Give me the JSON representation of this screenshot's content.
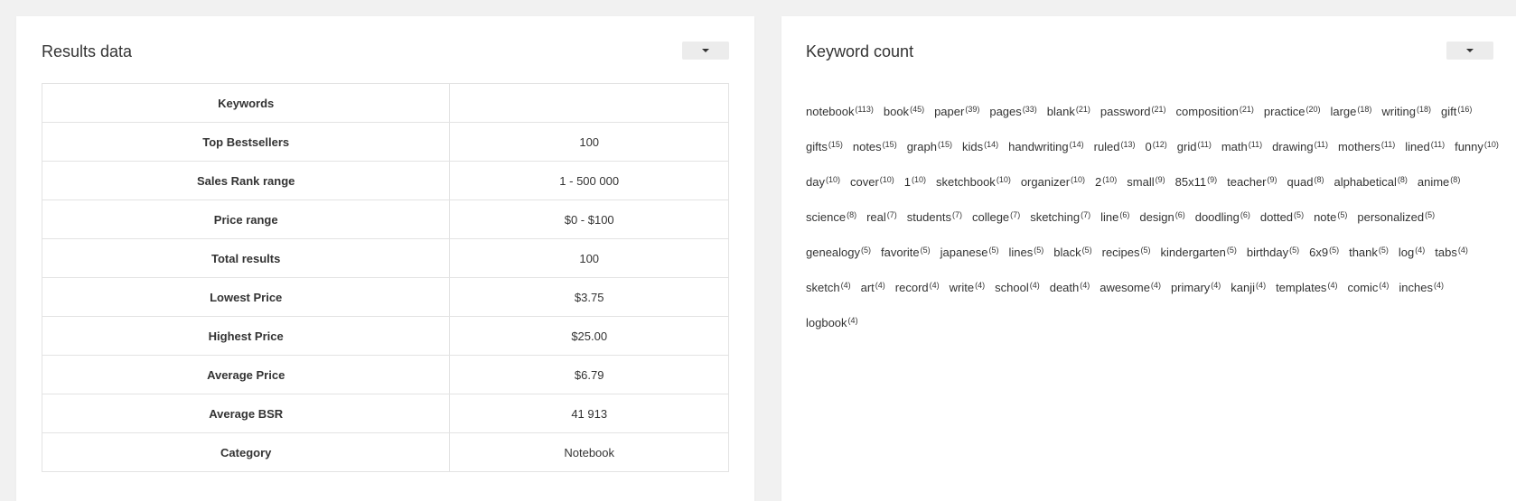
{
  "results_panel": {
    "title": "Results data",
    "rows": [
      {
        "label": "Keywords",
        "value": ""
      },
      {
        "label": "Top Bestsellers",
        "value": "100"
      },
      {
        "label": "Sales Rank range",
        "value": "1 - 500 000"
      },
      {
        "label": "Price range",
        "value": "$0 - $100"
      },
      {
        "label": "Total results",
        "value": "100"
      },
      {
        "label": "Lowest Price",
        "value": "$3.75"
      },
      {
        "label": "Highest Price",
        "value": "$25.00"
      },
      {
        "label": "Average Price",
        "value": "$6.79"
      },
      {
        "label": "Average BSR",
        "value": "41 913"
      },
      {
        "label": "Category",
        "value": "Notebook"
      }
    ]
  },
  "keyword_panel": {
    "title": "Keyword count",
    "keywords": [
      {
        "word": "notebook",
        "count": "113"
      },
      {
        "word": "book",
        "count": "45"
      },
      {
        "word": "paper",
        "count": "39"
      },
      {
        "word": "pages",
        "count": "33"
      },
      {
        "word": "blank",
        "count": "21"
      },
      {
        "word": "password",
        "count": "21"
      },
      {
        "word": "composition",
        "count": "21"
      },
      {
        "word": "practice",
        "count": "20"
      },
      {
        "word": "large",
        "count": "18"
      },
      {
        "word": "writing",
        "count": "18"
      },
      {
        "word": "gift",
        "count": "16"
      },
      {
        "word": "gifts",
        "count": "15"
      },
      {
        "word": "notes",
        "count": "15"
      },
      {
        "word": "graph",
        "count": "15"
      },
      {
        "word": "kids",
        "count": "14"
      },
      {
        "word": "handwriting",
        "count": "14"
      },
      {
        "word": "ruled",
        "count": "13"
      },
      {
        "word": "0",
        "count": "12"
      },
      {
        "word": "grid",
        "count": "11"
      },
      {
        "word": "math",
        "count": "11"
      },
      {
        "word": "drawing",
        "count": "11"
      },
      {
        "word": "mothers",
        "count": "11"
      },
      {
        "word": "lined",
        "count": "11"
      },
      {
        "word": "funny",
        "count": "10"
      },
      {
        "word": "day",
        "count": "10"
      },
      {
        "word": "cover",
        "count": "10"
      },
      {
        "word": "1",
        "count": "10"
      },
      {
        "word": "sketchbook",
        "count": "10"
      },
      {
        "word": "organizer",
        "count": "10"
      },
      {
        "word": "2",
        "count": "10"
      },
      {
        "word": "small",
        "count": "9"
      },
      {
        "word": "85x11",
        "count": "9"
      },
      {
        "word": "teacher",
        "count": "9"
      },
      {
        "word": "quad",
        "count": "8"
      },
      {
        "word": "alphabetical",
        "count": "8"
      },
      {
        "word": "anime",
        "count": "8"
      },
      {
        "word": "science",
        "count": "8"
      },
      {
        "word": "real",
        "count": "7"
      },
      {
        "word": "students",
        "count": "7"
      },
      {
        "word": "college",
        "count": "7"
      },
      {
        "word": "sketching",
        "count": "7"
      },
      {
        "word": "line",
        "count": "6"
      },
      {
        "word": "design",
        "count": "6"
      },
      {
        "word": "doodling",
        "count": "6"
      },
      {
        "word": "dotted",
        "count": "5"
      },
      {
        "word": "note",
        "count": "5"
      },
      {
        "word": "personalized",
        "count": "5"
      },
      {
        "word": "genealogy",
        "count": "5"
      },
      {
        "word": "favorite",
        "count": "5"
      },
      {
        "word": "japanese",
        "count": "5"
      },
      {
        "word": "lines",
        "count": "5"
      },
      {
        "word": "black",
        "count": "5"
      },
      {
        "word": "recipes",
        "count": "5"
      },
      {
        "word": "kindergarten",
        "count": "5"
      },
      {
        "word": "birthday",
        "count": "5"
      },
      {
        "word": "6x9",
        "count": "5"
      },
      {
        "word": "thank",
        "count": "5"
      },
      {
        "word": "log",
        "count": "4"
      },
      {
        "word": "tabs",
        "count": "4"
      },
      {
        "word": "sketch",
        "count": "4"
      },
      {
        "word": "art",
        "count": "4"
      },
      {
        "word": "record",
        "count": "4"
      },
      {
        "word": "write",
        "count": "4"
      },
      {
        "word": "school",
        "count": "4"
      },
      {
        "word": "death",
        "count": "4"
      },
      {
        "word": "awesome",
        "count": "4"
      },
      {
        "word": "primary",
        "count": "4"
      },
      {
        "word": "kanji",
        "count": "4"
      },
      {
        "word": "templates",
        "count": "4"
      },
      {
        "word": "comic",
        "count": "4"
      },
      {
        "word": "inches",
        "count": "4"
      },
      {
        "word": "logbook",
        "count": "4"
      }
    ]
  },
  "icons": {
    "dropdown": "caret-down-icon"
  }
}
